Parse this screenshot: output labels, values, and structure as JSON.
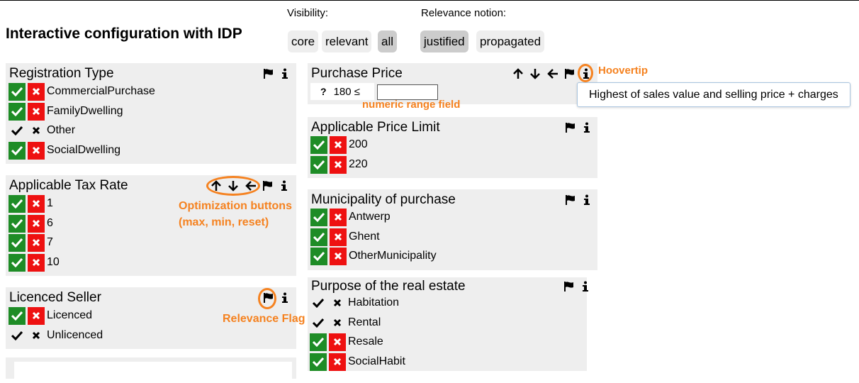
{
  "header": {
    "title": "Interactive configuration with IDP",
    "visibility_label": "Visibility:",
    "relevance_label": "Relevance notion:",
    "visibility_options": [
      {
        "label": "core",
        "selected": false
      },
      {
        "label": "relevant",
        "selected": false
      },
      {
        "label": "all",
        "selected": true
      }
    ],
    "relevance_options": [
      {
        "label": "justified",
        "selected": true
      },
      {
        "label": "propagated",
        "selected": false
      }
    ]
  },
  "cards": {
    "registration_type": {
      "title": "Registration Type",
      "items": [
        "CommercialPurchase",
        "FamilyDwelling",
        "Other",
        "SocialDwelling"
      ]
    },
    "tax_rate": {
      "title": "Applicable Tax Rate",
      "items": [
        "1",
        "6",
        "7",
        "10"
      ]
    },
    "licenced_seller": {
      "title": "Licenced Seller",
      "items": [
        "Licenced",
        "Unlicenced"
      ]
    },
    "purchase_price": {
      "title": "Purchase Price",
      "question_mark": "?",
      "range_text": "180 ≤",
      "input_value": ""
    },
    "price_limit": {
      "title": "Applicable Price Limit",
      "items": [
        "200",
        "220"
      ]
    },
    "municipality": {
      "title": "Municipality of purchase",
      "items": [
        "Antwerp",
        "Ghent",
        "OtherMunicipality"
      ]
    },
    "purpose": {
      "title": "Purpose of the real estate",
      "items": [
        "Habitation",
        "Rental",
        "Resale",
        "SocialHabit"
      ]
    }
  },
  "tooltip": "Highest of sales value and selling price + charges",
  "annotations": {
    "hoovertip": "Hoovertip",
    "numeric_range": "numeric range field",
    "optimization_line1": "Optimization buttons",
    "optimization_line2": "(max, min, reset)",
    "relevance_flag": "Relevance Flag"
  },
  "icons": {
    "check": "check-icon",
    "cross": "cross-icon",
    "flag": "flag-icon",
    "info": "info-icon",
    "arrow_up": "arrow-up-icon",
    "arrow_down": "arrow-down-icon",
    "arrow_left": "arrow-left-icon"
  },
  "colors": {
    "accept": "#1e8c26",
    "reject": "#ee1111",
    "annotation": "#f58220",
    "card_bg": "#eeeeee"
  }
}
